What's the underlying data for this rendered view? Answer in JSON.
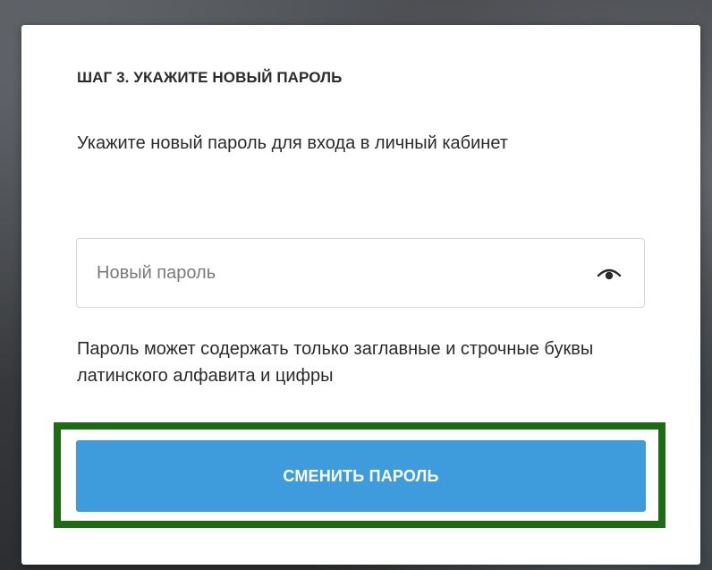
{
  "modal": {
    "step_title": "ШАГ 3. УКАЖИТЕ НОВЫЙ ПАРОЛЬ",
    "description": "Укажите новый пароль для входа в личный кабинет",
    "password_field": {
      "value": "",
      "placeholder": "Новый пароль",
      "toggle_icon": "eye-icon"
    },
    "hint": "Пароль может содержать только заглавные и строчные буквы латинского алфавита и цифры",
    "submit_label": "СМЕНИТЬ ПАРОЛЬ"
  },
  "colors": {
    "button_background": "#3e9cdd",
    "button_text": "#ffffff",
    "highlight_frame": "#1d6b12",
    "text": "#2b2b2b",
    "placeholder": "#7a7a7a",
    "field_border": "#d7d7d7"
  }
}
